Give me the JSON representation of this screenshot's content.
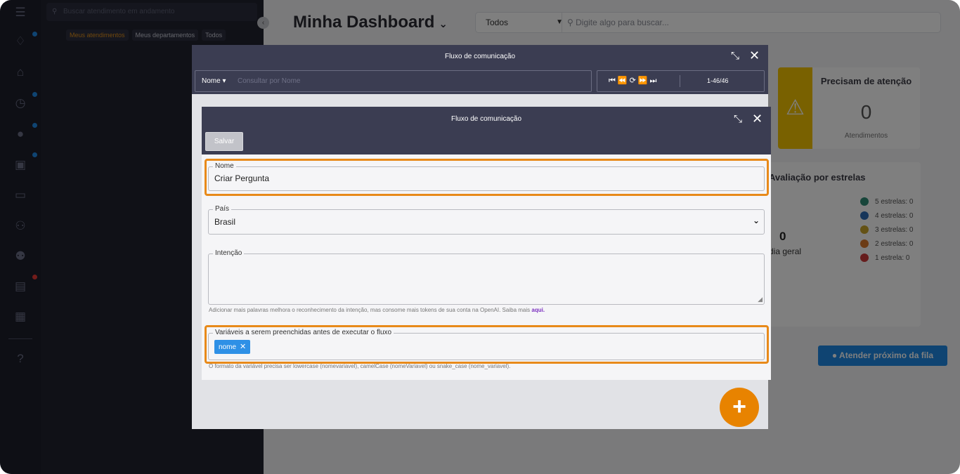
{
  "attendance": {
    "search_placeholder": "Buscar atendimento em andamento",
    "filters": [
      "Meus atendimentos",
      "Meus departamentos",
      "Todos"
    ]
  },
  "dashboard": {
    "title": "Minha Dashboard",
    "filter_value": "Todos",
    "search_placeholder": "Digite algo para buscar...",
    "attention_card": {
      "title": "Precisam de atenção",
      "value": "0",
      "subtitle": "Atendimentos"
    },
    "stars_card": {
      "title": "Avaliação por estrelas",
      "average": "0",
      "average_label": "dia geral",
      "legend": [
        {
          "label": "5 estrelas: 0",
          "color": "#2e8b74"
        },
        {
          "label": "4 estrelas: 0",
          "color": "#2f6db5"
        },
        {
          "label": "3 estrelas: 0",
          "color": "#c9a52a"
        },
        {
          "label": "2 estrelas: 0",
          "color": "#d9782d"
        },
        {
          "label": "1 estrela: 0",
          "color": "#cc3b3b"
        }
      ]
    },
    "next_button": "Atender próximo da fila"
  },
  "outer_modal": {
    "title": "Fluxo de comunicação",
    "search_by": "Nome",
    "search_placeholder": "Consultar por Nome",
    "pagination": "1-46/46"
  },
  "inner_modal": {
    "title": "Fluxo de comunicação",
    "save_label": "Salvar",
    "fields": {
      "name": {
        "label": "Nome",
        "value": "Criar Pergunta"
      },
      "country": {
        "label": "País",
        "value": "Brasil"
      },
      "intent": {
        "label": "Intenção",
        "value": "",
        "help": "Adicionar mais palavras melhora o reconhecimento da intenção, mas consome mais tokens de sua conta na OpenAI. Saiba mais",
        "help_link": "aqui."
      },
      "variables": {
        "label": "Variáveis a serem preenchidas antes de executar o fluxo",
        "chips": [
          "nome"
        ],
        "help": "O formato da variável precisa ser lowercase (nomevariavel), camelCase (nomeVariavel) ou snake_case (nome_variavel)."
      }
    }
  },
  "accent_color": "#e88a1a"
}
